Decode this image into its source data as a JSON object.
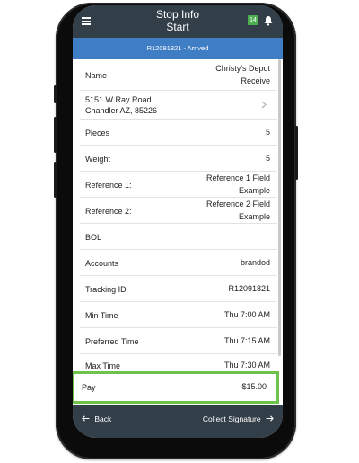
{
  "header": {
    "title_line1": "Stop Info",
    "title_line2": "Start",
    "badge_count": "14",
    "status_text": "R12091821 - Arrived"
  },
  "details": {
    "name_label": "Name",
    "name_value_line1": "Christy's Depot",
    "name_value_line2": "Receive",
    "address_line1": "5151 W Ray Road",
    "address_line2": "Chandler AZ, 85226",
    "pieces_label": "Pieces",
    "pieces_value": "5",
    "weight_label": "Weight",
    "weight_value": "5",
    "ref1_label": "Reference 1:",
    "ref1_value_line1": "Reference 1 Field",
    "ref1_value_line2": "Example",
    "ref2_label": "Reference 2:",
    "ref2_value_line1": "Reference 2 Field",
    "ref2_value_line2": "Example",
    "bol_label": "BOL",
    "accounts_label": "Accounts",
    "accounts_value": "brandod",
    "tracking_label": "Tracking ID",
    "tracking_value": "R12091821",
    "mintime_label": "Min Time",
    "mintime_value": "Thu 7:00 AM",
    "preftime_label": "Preferred Time",
    "preftime_value": "Thu 7:15 AM",
    "maxtime_label": "Max Time",
    "maxtime_value": "Thu 7:30 AM",
    "pay_label": "Pay",
    "pay_value": "$15.00"
  },
  "footer": {
    "back_label": "Back",
    "collect_label": "Collect Signature"
  },
  "colors": {
    "header_bg": "#323e48",
    "status_bar_bg": "#3f7dc4",
    "highlight_border": "#6cc24a",
    "badge_bg": "#4caf50"
  },
  "icons": [
    "hamburger-menu-icon",
    "bell-icon",
    "chevron-right-icon",
    "arrow-left-icon",
    "arrow-right-icon"
  ]
}
